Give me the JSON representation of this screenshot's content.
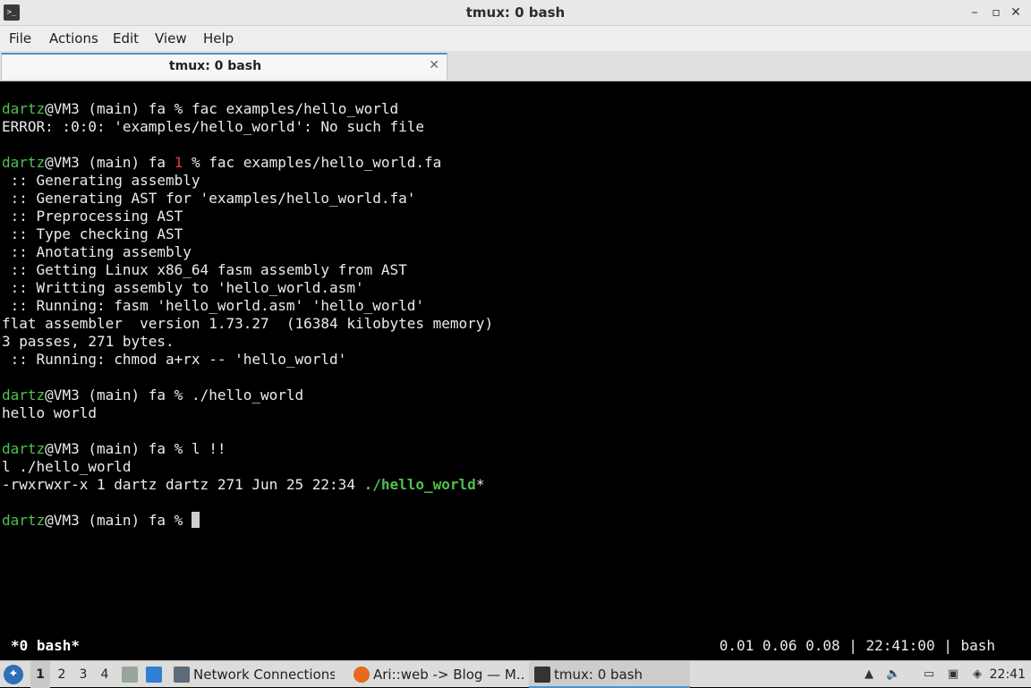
{
  "window": {
    "title": "tmux: 0 bash",
    "controls": {
      "minimize": "–",
      "maximize": "▫",
      "close": "✕"
    }
  },
  "menu": [
    "File",
    "Actions",
    "Edit",
    "View",
    "Help"
  ],
  "tab": {
    "label": "tmux: 0 bash",
    "close": "✕"
  },
  "terminal": {
    "user": "dartz",
    "host_suffix": "@VM3 (main) fa ",
    "lines": {
      "l1_cmd": "% fac examples/hello_world",
      "l2": "ERROR: :0:0: 'examples/hello_world': No such file",
      "l4_code": "1",
      "l4_cmd": " % fac examples/hello_world.fa",
      "l5": " :: Generating assembly",
      "l6": " :: Generating AST for 'examples/hello_world.fa'",
      "l7": " :: Preprocessing AST",
      "l8": " :: Type checking AST",
      "l9": " :: Anotating assembly",
      "l10": " :: Getting Linux x86_64 fasm assembly from AST",
      "l11": " :: Writting assembly to 'hello_world.asm'",
      "l12": " :: Running: fasm 'hello_world.asm' 'hello_world'",
      "l13": "flat assembler  version 1.73.27  (16384 kilobytes memory)",
      "l14": "3 passes, 271 bytes.",
      "l15": " :: Running: chmod a+rx -- 'hello_world'",
      "l17_cmd": "% ./hello_world",
      "l18": "hello world",
      "l20_cmd": "% l !!",
      "l21": "l ./hello_world",
      "l22_perm": "-rwxrwxr-x 1 dartz dartz 271 Jun 25 22:34 ",
      "l22_file": "./hello_world",
      "l22_suffix": "*",
      "l24_cmd": "% "
    },
    "status_left": "*0 bash*",
    "status_right": "0.01 0.06 0.08 | 22:41:00 | bash"
  },
  "taskbar": {
    "workspaces": [
      "1",
      "2",
      "3",
      "4"
    ],
    "active_workspace": "1",
    "tasks": [
      {
        "label": "Network Connections",
        "icon": "network-icon"
      },
      {
        "label": "Ari::web -> Blog — M...",
        "icon": "firefox-icon"
      },
      {
        "label": "tmux: 0 bash",
        "icon": "terminal-icon"
      }
    ],
    "clock": "22:41"
  },
  "colors": {
    "prompt_user": "#4ec24e",
    "exit_code": "#e33d3d",
    "accent": "#4a90d9",
    "terminal_bg": "#000000"
  }
}
